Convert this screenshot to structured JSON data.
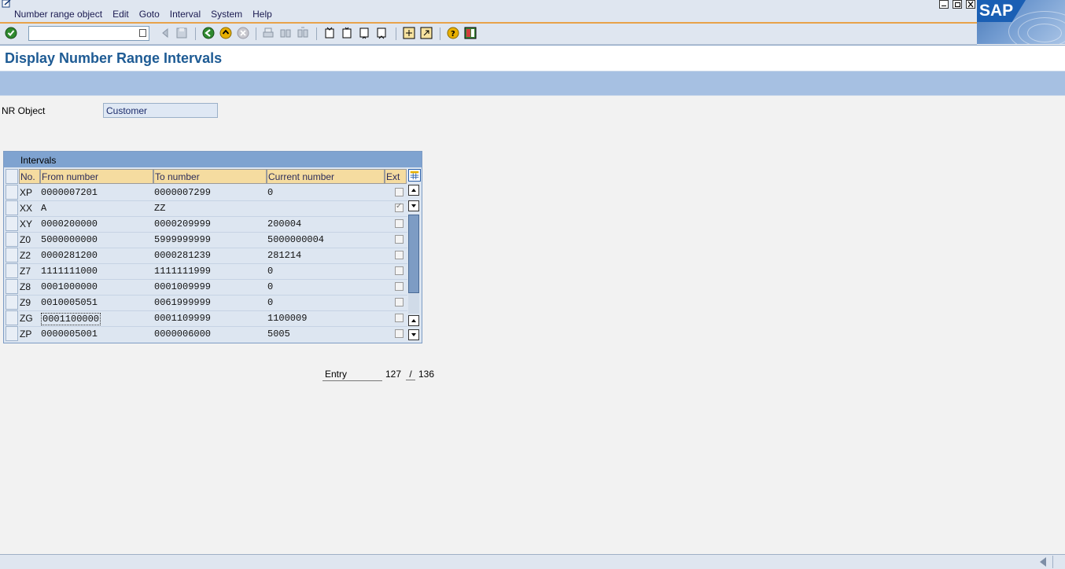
{
  "menu": [
    "Number range object",
    "Edit",
    "Goto",
    "Interval",
    "System",
    "Help"
  ],
  "logo": "SAP",
  "toolbar": {
    "command_value": "",
    "icons": [
      "enter-icon",
      "back-icon",
      "save-icon",
      "nav-back-icon",
      "exit-icon",
      "cancel-icon",
      "print-icon",
      "find-icon",
      "find-next-icon",
      "first-page-icon",
      "prev-page-icon",
      "next-page-icon",
      "last-page-icon",
      "create-session-icon",
      "shortcut-icon",
      "help-icon",
      "layout-icon"
    ]
  },
  "title": "Display Number Range Intervals",
  "nr_object": {
    "label": "NR Object",
    "value": "Customer"
  },
  "intervals": {
    "title": "Intervals",
    "columns": [
      "No.",
      "From number",
      "To number",
      "Current number",
      "Ext"
    ],
    "rows": [
      {
        "no": "XP",
        "from": "0000007201",
        "to": "0000007299",
        "current": "0",
        "ext": false
      },
      {
        "no": "XX",
        "from": "A",
        "to": "ZZ",
        "current": "",
        "ext": true
      },
      {
        "no": "XY",
        "from": "0000200000",
        "to": "0000209999",
        "current": "200004",
        "ext": false
      },
      {
        "no": "Z0",
        "from": "5000000000",
        "to": "5999999999",
        "current": "5000000004",
        "ext": false
      },
      {
        "no": "Z2",
        "from": "0000281200",
        "to": "0000281239",
        "current": "281214",
        "ext": false
      },
      {
        "no": "Z7",
        "from": "1111111000",
        "to": "1111111999",
        "current": "0",
        "ext": false
      },
      {
        "no": "Z8",
        "from": "0001000000",
        "to": "0001009999",
        "current": "0",
        "ext": false
      },
      {
        "no": "Z9",
        "from": "0010005051",
        "to": "0061999999",
        "current": "0",
        "ext": false
      },
      {
        "no": "ZG",
        "from": "0001100000",
        "to": "0001109999",
        "current": "1100009",
        "ext": false
      },
      {
        "no": "ZP",
        "from": "0000005001",
        "to": "0000006000",
        "current": "5005",
        "ext": false
      }
    ]
  },
  "entry": {
    "label": "Entry",
    "current": "127",
    "separator": "/",
    "total": "136"
  },
  "colors": {
    "accent": "#1e5b94",
    "header_bg": "#f5dca0",
    "table_bg": "#dde6f1",
    "bar": "#a6c0e2"
  }
}
